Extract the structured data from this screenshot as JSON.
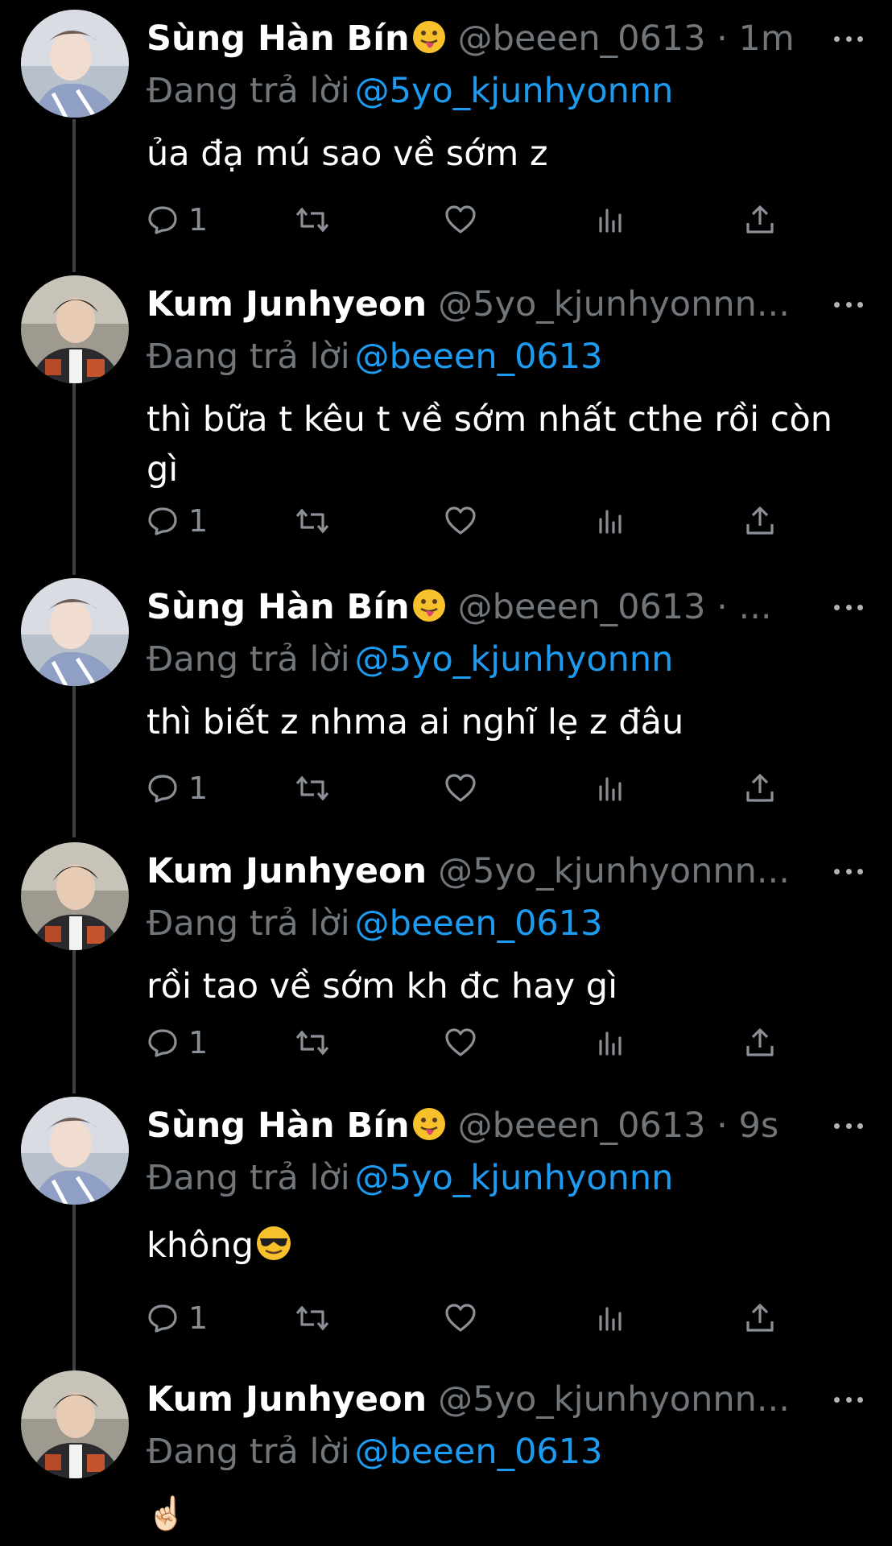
{
  "reply_prefix": "Đang trả lời",
  "colors": {
    "background": "#000000",
    "text": "#ffffff",
    "secondary": "#71767b",
    "link": "#1d9bf0",
    "thread_line": "#3e4144"
  },
  "tweets": [
    {
      "name": "Sùng Hàn Bín",
      "name_emoji": "tongue-out-emoji",
      "handle_line": "@beeen_0613 · 1m",
      "replying_to": "@5yo_kjunhyonnn",
      "text": "ủa đạ mú sao về sớm z",
      "reply_count": "1",
      "avatar": "avatar-sung-han-bin"
    },
    {
      "name": "Kum Junhyeon",
      "handle_line": "@5yo_kjunhyonnn...",
      "replying_to": "@beeen_0613",
      "text": "thì bữa t kêu t về sớm nhất cthe rồi còn gì",
      "reply_count": "1",
      "avatar": "avatar-kum-junhyeon"
    },
    {
      "name": "Sùng Hàn Bín",
      "name_emoji": "tongue-out-emoji",
      "handle_line": "@beeen_0613 · ...",
      "replying_to": "@5yo_kjunhyonnn",
      "text": "thì biết z nhma ai nghĩ lẹ z đâu",
      "reply_count": "1",
      "avatar": "avatar-sung-han-bin"
    },
    {
      "name": "Kum Junhyeon",
      "handle_line": "@5yo_kjunhyonnn...",
      "replying_to": "@beeen_0613",
      "text": "rồi tao về sớm kh đc hay gì",
      "reply_count": "1",
      "avatar": "avatar-kum-junhyeon"
    },
    {
      "name": "Sùng Hàn Bín",
      "name_emoji": "tongue-out-emoji",
      "handle_line": "@beeen_0613 · 9s",
      "replying_to": "@5yo_kjunhyonnn",
      "text": "không",
      "text_emoji": "sunglasses-emoji",
      "reply_count": "1",
      "avatar": "avatar-sung-han-bin"
    },
    {
      "name": "Kum Junhyeon",
      "handle_line": "@5yo_kjunhyonnn...",
      "replying_to": "@beeen_0613",
      "text": "☝🏻",
      "avatar": "avatar-kum-junhyeon"
    }
  ]
}
